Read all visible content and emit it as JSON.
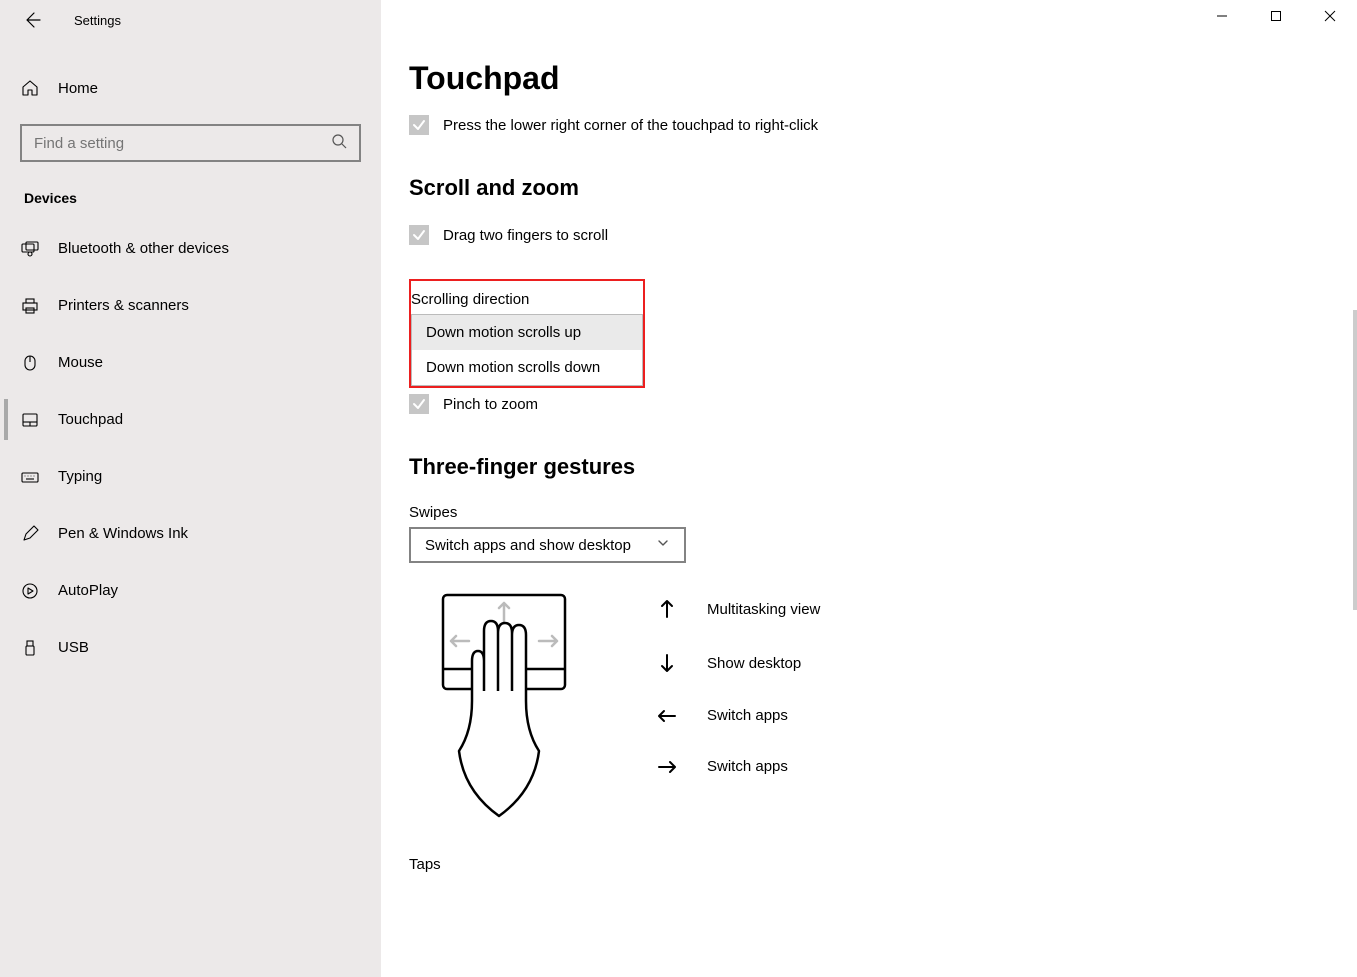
{
  "title": "Settings",
  "home_label": "Home",
  "search": {
    "placeholder": "Find a setting"
  },
  "category": "Devices",
  "nav": [
    {
      "label": "Bluetooth & other devices"
    },
    {
      "label": "Printers & scanners"
    },
    {
      "label": "Mouse"
    },
    {
      "label": "Touchpad"
    },
    {
      "label": "Typing"
    },
    {
      "label": "Pen & Windows Ink"
    },
    {
      "label": "AutoPlay"
    },
    {
      "label": "USB"
    }
  ],
  "page": {
    "title": "Touchpad",
    "right_click_label": "Press the lower right corner of the touchpad to right-click",
    "scroll_zoom_heading": "Scroll and zoom",
    "drag_scroll_label": "Drag two fingers to scroll",
    "scroll_dir_label": "Scrolling direction",
    "scroll_dir_options": [
      "Down motion scrolls up",
      "Down motion scrolls down"
    ],
    "pinch_zoom_label": "Pinch to zoom",
    "three_finger_heading": "Three-finger gestures",
    "swipes_label": "Swipes",
    "swipes_value": "Switch apps and show desktop",
    "gestures": {
      "up": "Multitasking view",
      "down": "Show desktop",
      "left": "Switch apps",
      "right": "Switch apps"
    },
    "taps_label": "Taps"
  }
}
